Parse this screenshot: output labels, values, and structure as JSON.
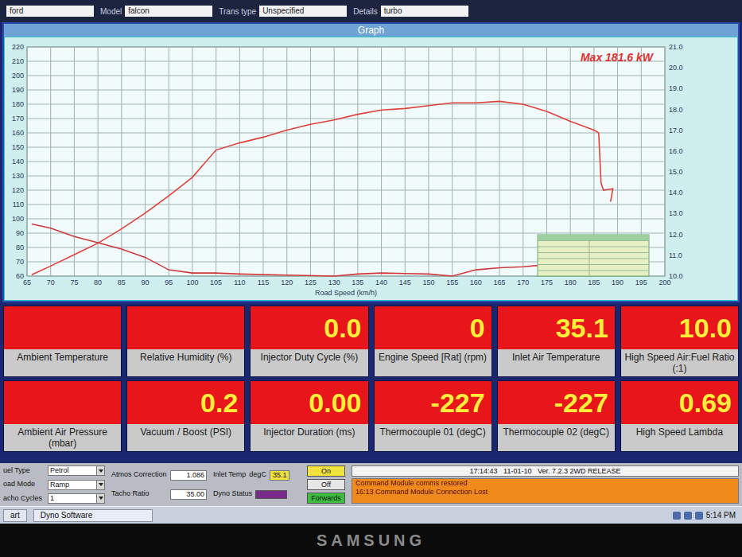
{
  "header": {
    "fields": [
      {
        "value": "ford"
      },
      {
        "label": "Model",
        "value": "falcon"
      },
      {
        "label": "Trans type",
        "value": "Unspecified"
      },
      {
        "label": "Details",
        "value": "turbo"
      }
    ]
  },
  "graph": {
    "title": "Graph",
    "max_label": "Max 181.6 kW",
    "x_title": "Road Speed (km/h)",
    "x_ticks": [
      "65",
      "70",
      "75",
      "80",
      "85",
      "90",
      "95",
      "100",
      "105",
      "110",
      "115",
      "120",
      "125",
      "130",
      "135",
      "140",
      "145",
      "150",
      "155",
      "160",
      "165",
      "170",
      "175",
      "180",
      "185",
      "190",
      "195",
      "200"
    ],
    "y_ticks": [
      "60",
      "70",
      "80",
      "90",
      "100",
      "110",
      "120",
      "130",
      "140",
      "150",
      "160",
      "170",
      "180",
      "190",
      "200",
      "210",
      "220"
    ],
    "y2_ticks": [
      "10.0",
      "11.0",
      "12.0",
      "13.0",
      "14.0",
      "15.0",
      "16.0",
      "17.0",
      "18.0",
      "19.0",
      "20.0",
      "21.0"
    ],
    "power": {
      "color": "#e0403a",
      "x": [
        66,
        70,
        75,
        80,
        85,
        90,
        95,
        100,
        105,
        110,
        115,
        120,
        125,
        130,
        135,
        140,
        145,
        150,
        155,
        160,
        165,
        170,
        175,
        180,
        185,
        186,
        186.5,
        187,
        189,
        188.5
      ],
      "values": [
        61,
        67,
        75,
        83,
        93,
        104,
        116,
        129,
        148,
        153,
        157,
        162,
        166,
        169,
        173,
        176,
        177,
        179,
        181,
        181,
        182,
        180,
        175,
        168,
        162,
        160,
        125,
        120,
        121,
        112
      ]
    },
    "afr": {
      "color": "#d0383a",
      "x": [
        66,
        70,
        75,
        80,
        85,
        90,
        95,
        100,
        105,
        110,
        120,
        130,
        135,
        140,
        150,
        155,
        160,
        165,
        170,
        175
      ],
      "values": [
        12.5,
        12.3,
        11.9,
        11.6,
        11.3,
        10.9,
        10.3,
        10.15,
        10.15,
        10.1,
        10.05,
        10.0,
        10.1,
        10.15,
        10.1,
        10.0,
        10.3,
        10.4,
        10.45,
        10.55
      ]
    }
  },
  "tiles": [
    {
      "label": "Ambient Temperature",
      "value": ""
    },
    {
      "label": "Relative Humidity (%)",
      "value": ""
    },
    {
      "label": "Injector Duty Cycle (%)",
      "value": "0.0"
    },
    {
      "label": "Engine Speed [Rat] (rpm)",
      "value": "0"
    },
    {
      "label": "Inlet Air Temperature",
      "value": "35.1"
    },
    {
      "label": "High Speed Air:Fuel Ratio (:1)",
      "value": "10.0"
    },
    {
      "label": "Ambient Air Pressure (mbar)",
      "value": ""
    },
    {
      "label": "Vacuum / Boost (PSI)",
      "value": "0.2"
    },
    {
      "label": "Injector Duration (ms)",
      "value": "0.00"
    },
    {
      "label": "Thermocouple 01 (degC)",
      "value": "-227"
    },
    {
      "label": "Thermocouple 02 (degC)",
      "value": "-227"
    },
    {
      "label": "High Speed Lambda",
      "value": "0.69"
    }
  ],
  "controls": {
    "settings": [
      {
        "label": "uel Type",
        "value": "Petrol"
      },
      {
        "label": "oad Mode",
        "value": "Ramp"
      },
      {
        "label": "acho Cycles",
        "value": "1"
      }
    ],
    "corrections": [
      {
        "label": "Atmos Correction",
        "value": "1.086"
      },
      {
        "label": "Tacho Ratio",
        "value": "35.00"
      }
    ],
    "inlet": {
      "label": "Inlet Temp",
      "unit": "degC",
      "value": "35.1"
    },
    "dyno_status": {
      "label": "Dyno Status"
    },
    "buttons": [
      {
        "label": "On",
        "color": "#f2e23c"
      },
      {
        "label": "Off",
        "color": "#e6e6e6"
      },
      {
        "label": "Forwards",
        "color": "#3cbf3c"
      }
    ]
  },
  "status": {
    "line": "17:14:43   11-01-10   Ver. 7.2.3 2WD RELEASE",
    "messages": [
      "Command Module comms restored",
      "16:13 Command Module Connection Lost"
    ]
  },
  "taskbar": {
    "start": "art",
    "app": "Dyno Software",
    "clock": "5:14 PM"
  },
  "monitor": {
    "brand": "SAMSUNG"
  }
}
